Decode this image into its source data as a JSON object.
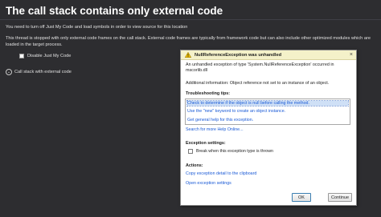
{
  "page": {
    "title": "The call stack contains only external code",
    "intro": "You need to turn off Just My Code and load symbols in order to view source for this location",
    "description": "This thread is stopped with only external code frames on the call stack. External code frames are typically from framework code but can also include other optimized modules which are loaded in the target process.",
    "disable_jmc_label": "Disable Just My Code",
    "call_stack_label": "Call stack with external code"
  },
  "popup": {
    "title": "NullReferenceException was unhandled",
    "message": "An unhandled exception of type 'System.NullReferenceException' occurred in mscorlib.dll",
    "additional_info": "Additional information: Object reference not set to an instance of an object.",
    "tips_label": "Troubleshooting tips:",
    "tips": [
      "Check to determine if the object is null before calling the method.",
      "Use the \"new\" keyword to create an object instance.",
      "Get general help for this exception."
    ],
    "help_link": "Search for more Help Online...",
    "settings_label": "Exception settings:",
    "break_label": "Break when this exception type is thrown",
    "actions_label": "Actions:",
    "actions": [
      "Copy exception detail to the clipboard",
      "Open exception settings"
    ],
    "ok_label": "OK",
    "continue_label": "Continue",
    "close_glyph": "×"
  },
  "icons": {
    "warning": "warning-icon",
    "close": "close-icon",
    "call_stack": "chevron-icon"
  },
  "colors": {
    "background": "#2d2d30",
    "popup_header": "#f4f1c9",
    "link": "#1a5ad6",
    "selected_tip": "#cfe0f6"
  }
}
